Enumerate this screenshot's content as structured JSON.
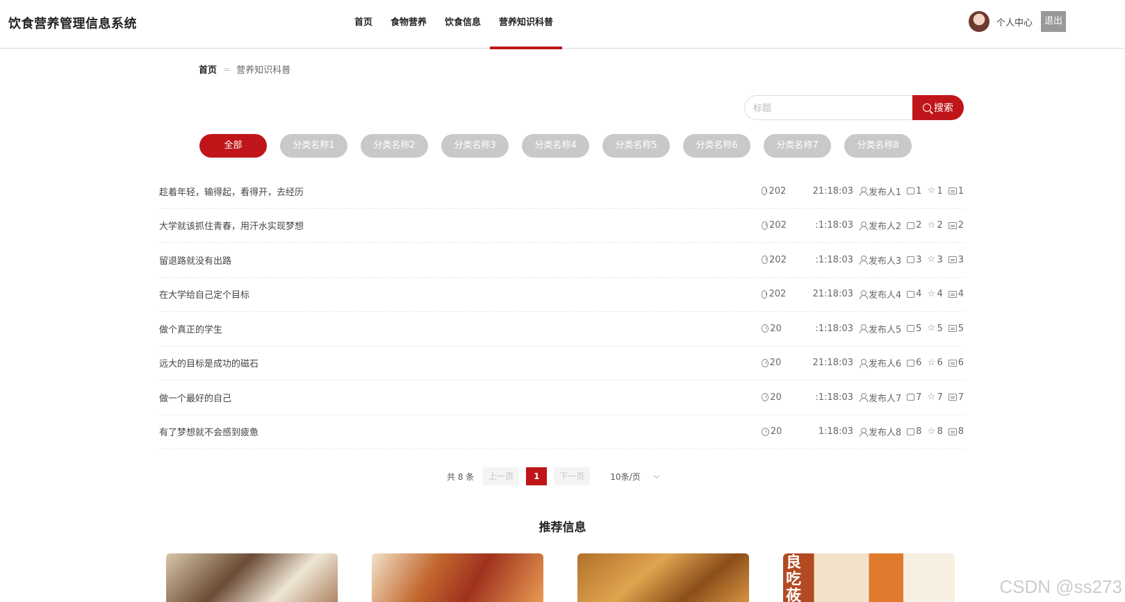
{
  "header": {
    "logo": "饮食营养管理信息系统",
    "nav": [
      "首页",
      "食物营养",
      "饮食信息",
      "营养知识科普"
    ],
    "active_nav": 3,
    "user_center": "个人中心",
    "logout": "退出"
  },
  "breadcrumb": {
    "home": "首页",
    "separator": "=",
    "current": "营养知识科普"
  },
  "search": {
    "placeholder": "标题",
    "button": "搜索"
  },
  "categories": [
    "全部",
    "分类名称1",
    "分类名称2",
    "分类名称3",
    "分类名称4",
    "分类名称5",
    "分类名称6",
    "分类名称7",
    "分类名称8"
  ],
  "list": [
    {
      "title": "趁着年轻，输得起，看得开，去经历",
      "time_pre": "202",
      "time_post": "21:18:03",
      "author": "发布人1",
      "likes": "1",
      "stars": "1",
      "comments": "1"
    },
    {
      "title": "大学就该抓住青春，用汗水实现梦想",
      "time_pre": "202",
      "time_post": ":1:18:03",
      "author": "发布人2",
      "likes": "2",
      "stars": "2",
      "comments": "2"
    },
    {
      "title": "留退路就没有出路",
      "time_pre": "202",
      "time_post": ":1:18:03",
      "author": "发布人3",
      "likes": "3",
      "stars": "3",
      "comments": "3"
    },
    {
      "title": "在大学给自己定个目标",
      "time_pre": "202",
      "time_post": "21:18:03",
      "author": "发布人4",
      "likes": "4",
      "stars": "4",
      "comments": "4"
    },
    {
      "title": "做个真正的学生",
      "time_pre": "20",
      "time_post": ":1:18:03",
      "author": "发布人5",
      "likes": "5",
      "stars": "5",
      "comments": "5"
    },
    {
      "title": "远大的目标是成功的磁石",
      "time_pre": "20",
      "time_post": "21:18:03",
      "author": "发布人6",
      "likes": "6",
      "stars": "6",
      "comments": "6"
    },
    {
      "title": "做一个最好的自己",
      "time_pre": "20",
      "time_post": ":1:18:03",
      "author": "发布人7",
      "likes": "7",
      "stars": "7",
      "comments": "7"
    },
    {
      "title": "有了梦想就不会感到疲惫",
      "time_pre": "20",
      "time_post": "1:18:03",
      "author": "发布人8",
      "likes": "8",
      "stars": "8",
      "comments": "8"
    }
  ],
  "pagination": {
    "total": "共 8 条",
    "prev": "上一页",
    "current": "1",
    "next": "下一页",
    "page_size": "10条/页"
  },
  "recommend": {
    "title": "推荐信息",
    "card4_text": "良吃莜"
  },
  "watermark": "CSDN @ss273"
}
